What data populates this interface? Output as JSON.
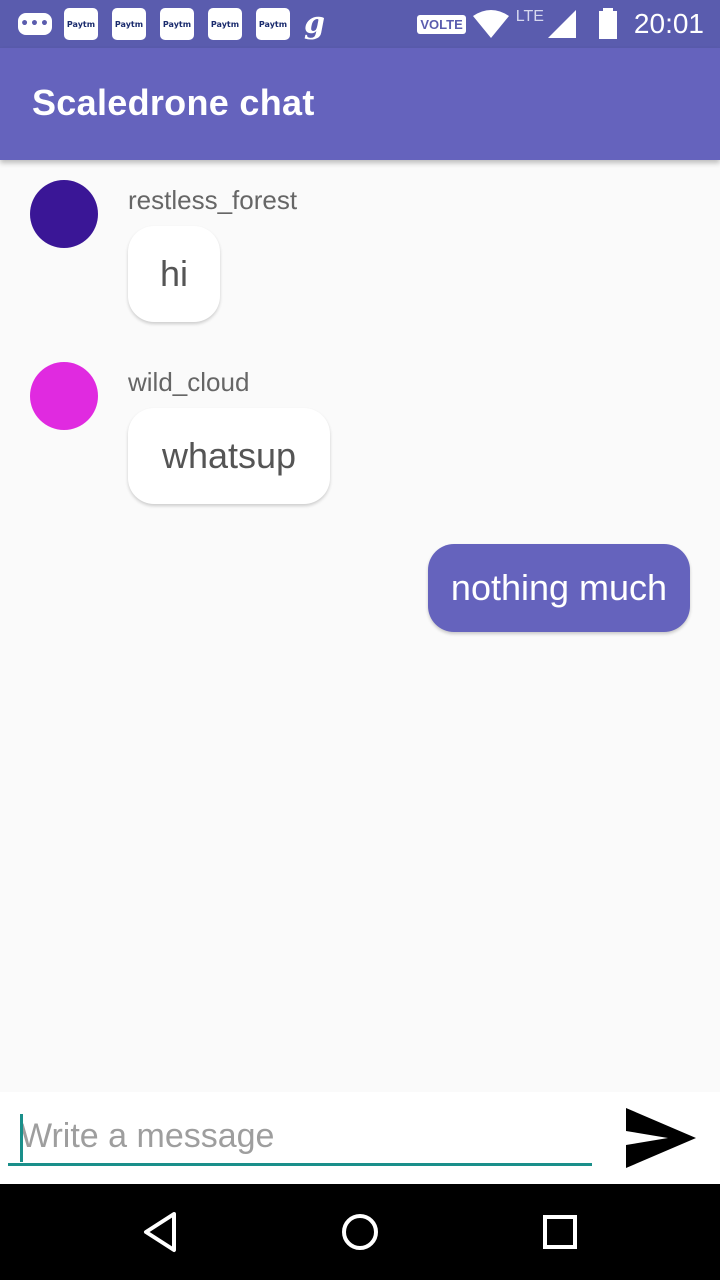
{
  "status_bar": {
    "more_notifications_icon": "three-dots-icon",
    "notification_icons": [
      "Paytm",
      "Paytm",
      "Paytm",
      "Paytm",
      "Paytm"
    ],
    "g_icon_text": "g",
    "volte": "VOLTE",
    "network": "LTE",
    "time": "20:01"
  },
  "app_bar": {
    "title": "Scaledrone chat",
    "color": "#6563bd"
  },
  "messages": [
    {
      "username": "restless_forest",
      "text": "hi",
      "avatar_color": "#3a1696",
      "from_me": false
    },
    {
      "username": "wild_cloud",
      "text": "whatsup",
      "avatar_color": "#e02ae0",
      "from_me": false
    },
    {
      "text": "nothing much",
      "bubble_color": "#6563bd",
      "from_me": true
    }
  ],
  "composer": {
    "placeholder": "Write a message",
    "value": "",
    "send_icon": "send-icon",
    "accent": "#1a8f8a"
  },
  "nav_bar": {
    "back_icon": "back-triangle-icon",
    "home_icon": "home-circle-icon",
    "recents_icon": "recents-square-icon"
  }
}
